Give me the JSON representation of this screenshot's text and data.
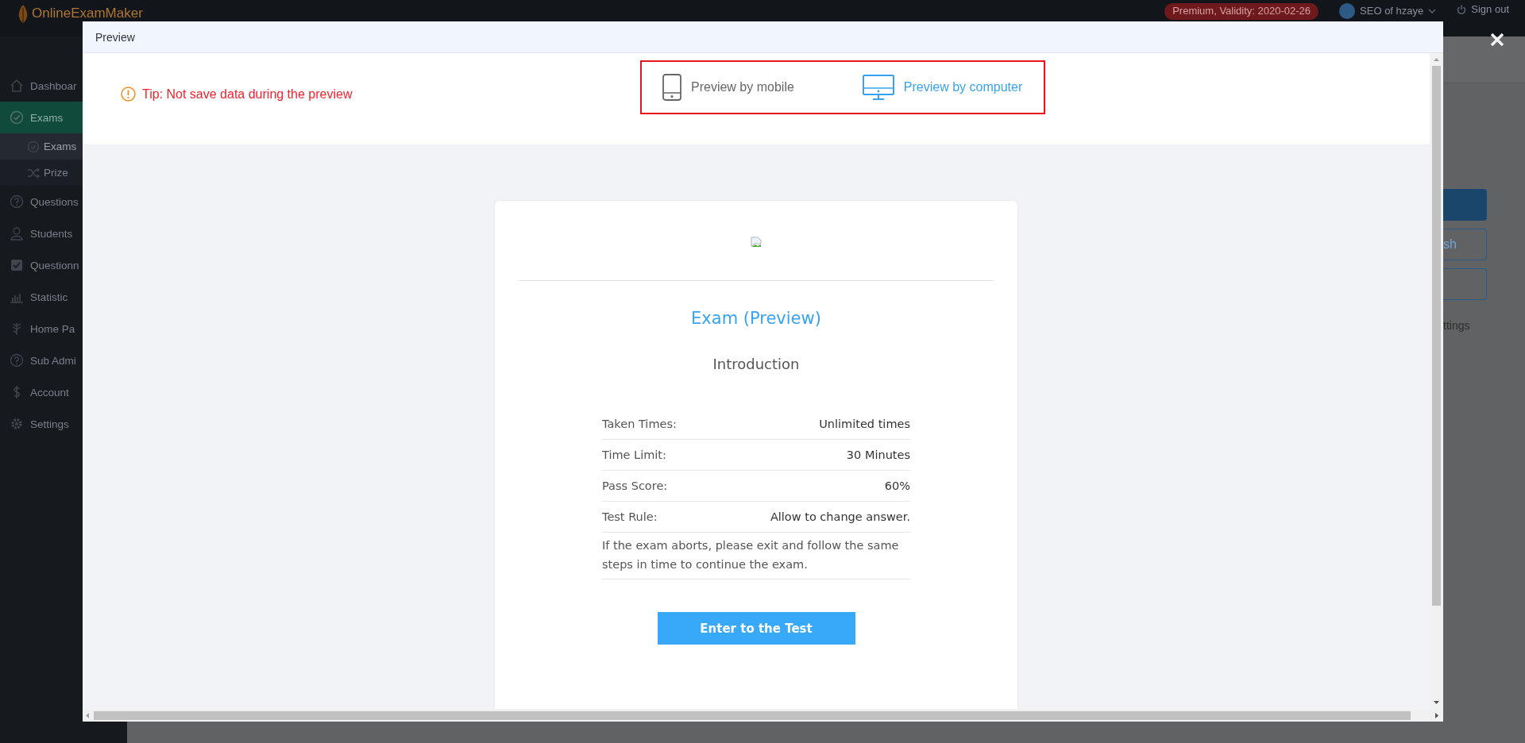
{
  "topbar": {
    "logo": "OnlineExamMaker",
    "plan_badge": "Premium, Validity: 2020-02-26",
    "user": "SEO of hzaye",
    "sign_out": "Sign out"
  },
  "sidebar": {
    "items": [
      {
        "label": "Dashboar",
        "selected": false
      },
      {
        "label": "Exams",
        "selected": true,
        "expanded": true,
        "children": [
          {
            "label": "Exams",
            "selected": true
          },
          {
            "label": "Prize",
            "selected": false
          }
        ]
      },
      {
        "label": "Questions",
        "selected": false
      },
      {
        "label": "Students",
        "selected": false
      },
      {
        "label": "Questionn",
        "selected": false
      },
      {
        "label": "Statistic",
        "selected": false
      },
      {
        "label": "Home Pa",
        "selected": false
      },
      {
        "label": "Sub Admi",
        "selected": false
      },
      {
        "label": "Account",
        "selected": false
      },
      {
        "label": "Settings",
        "selected": false
      }
    ]
  },
  "background_panel": {
    "buttons": [
      {
        "kind": "filled"
      },
      {
        "kind": "outline",
        "label": "sh"
      },
      {
        "kind": "outline"
      }
    ],
    "link": "ttings"
  },
  "modal": {
    "title": "Preview",
    "tip": "Tip: Not save data during the preview",
    "preview_modes": [
      {
        "label": "Preview by mobile",
        "selected": false
      },
      {
        "label": "Preview by computer",
        "selected": true
      }
    ],
    "card": {
      "title": "Exam (Preview)",
      "subtitle": "Introduction",
      "details": [
        {
          "label": "Taken Times:",
          "value": "Unlimited times"
        },
        {
          "label": "Time Limit:",
          "value": "30 Minutes"
        },
        {
          "label": "Pass Score:",
          "value": "60%"
        },
        {
          "label": "Test Rule:",
          "value": "Allow to change answer."
        }
      ],
      "note": "If the exam aborts, please exit and follow the same steps in time to continue the exam.",
      "button": "Enter to the Test"
    }
  }
}
